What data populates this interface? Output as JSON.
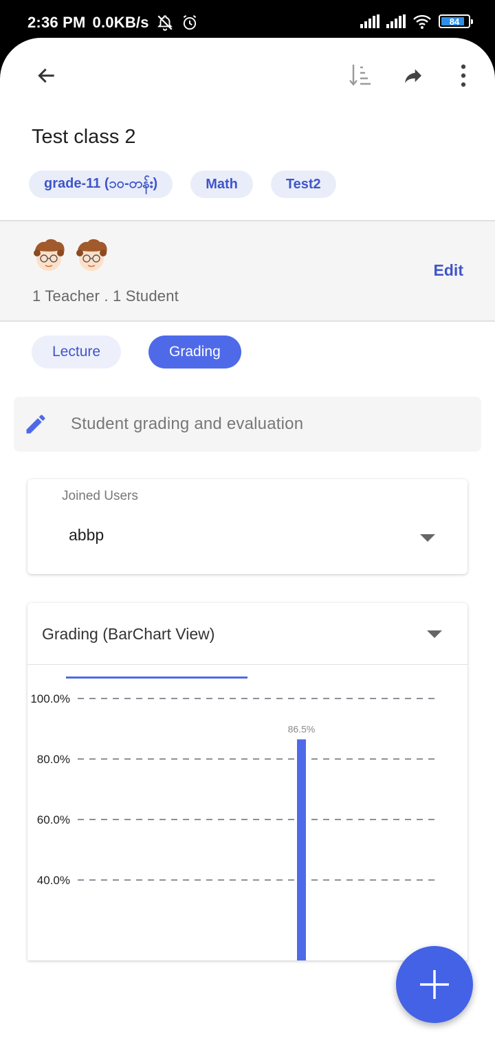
{
  "status_bar": {
    "time": "2:36 PM",
    "speed": "0.0KB/s",
    "battery": "84",
    "icons": [
      "mute-icon",
      "alarm-icon",
      "signal-icon",
      "signal-icon",
      "wifi-icon",
      "battery-icon"
    ]
  },
  "app_bar": {
    "icons": [
      "back-arrow-icon",
      "sort-icon",
      "share-icon",
      "more-vert-icon"
    ]
  },
  "class_title": "Test class 2",
  "tags": [
    "grade-11 (၁၀-တန်း)",
    "Math",
    "Test2"
  ],
  "members": {
    "count_text": "1 Teacher . 1 Student",
    "edit_label": "Edit"
  },
  "tabs": {
    "lecture": "Lecture",
    "grading": "Grading",
    "selected": "Grading"
  },
  "description": {
    "text": "Student grading and evaluation",
    "icon": "pencil-icon"
  },
  "joined_users": {
    "label": "Joined Users",
    "value": "abbp"
  },
  "grading_view": {
    "selected": "Grading (BarChart View)"
  },
  "chart_data": {
    "type": "bar",
    "y_ticks": [
      "100.0%",
      "80.0%",
      "60.0%",
      "40.0%"
    ],
    "values": [
      86.5
    ],
    "value_labels": [
      "86.5%"
    ],
    "ylim": [
      0,
      100
    ],
    "grid": true,
    "accent": "#4f6ae8"
  },
  "colors": {
    "accent": "#4f6ae8",
    "chip_bg": "#e9edf9",
    "fab": "#4462e6"
  },
  "fab": {
    "icon": "plus-icon"
  }
}
